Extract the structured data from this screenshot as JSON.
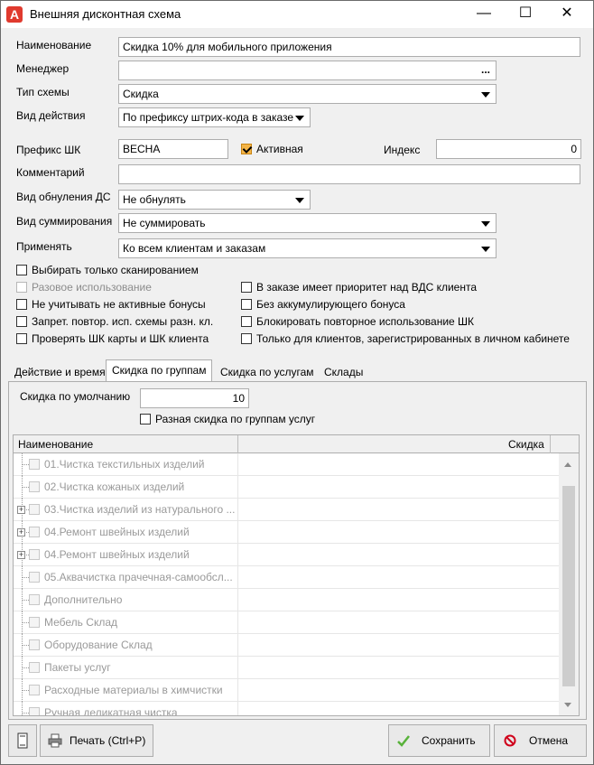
{
  "window": {
    "title": "Внешняя дисконтная схема",
    "icon_letter": "A",
    "minimize": "—",
    "maximize": "☐",
    "close": "✕"
  },
  "form": {
    "name_label": "Наименование",
    "name_value": "Скидка 10% для мобильного приложения",
    "manager_label": "Менеджер",
    "manager_value": "",
    "manager_button": "...",
    "scheme_type_label": "Тип схемы",
    "scheme_type_value": "Скидка",
    "action_type_label": "Вид действия",
    "action_type_value": "По префиксу штрих-кода в заказе",
    "prefix_label": "Префикс ШК",
    "prefix_value": "ВЕСНА",
    "active_label": "Активная",
    "active_checked": true,
    "index_label": "Индекс",
    "index_value": "0",
    "comment_label": "Комментарий",
    "comment_value": "",
    "reset_label": "Вид обнуления ДС",
    "reset_value": "Не обнулять",
    "sum_label": "Вид суммирования",
    "sum_value": "Не суммировать",
    "apply_label": "Применять",
    "apply_value": "Ко всем клиентам и заказам"
  },
  "options_left": [
    {
      "label": "Выбирать только сканированием",
      "checked": false,
      "disabled": false
    },
    {
      "label": "Разовое использование",
      "checked": false,
      "disabled": true
    },
    {
      "label": "Не учитывать не активные бонусы",
      "checked": false,
      "disabled": false
    },
    {
      "label": "Запрет. повтор. исп. схемы разн. кл.",
      "checked": false,
      "disabled": false
    },
    {
      "label": "Проверять ШК карты и ШК клиента",
      "checked": false,
      "disabled": false
    }
  ],
  "options_right": [
    {
      "label": "В заказе имеет приоритет над ВДС клиента",
      "checked": false
    },
    {
      "label": "Без аккумулирующего бонуса",
      "checked": false
    },
    {
      "label": "Блокировать повторное использование ШК",
      "checked": false
    },
    {
      "label": "Только для клиентов, зарегистрированных в личном кабинете",
      "checked": false
    }
  ],
  "tabs": [
    {
      "label": "Действие и время",
      "active": false
    },
    {
      "label": "Скидка по группам",
      "active": true
    },
    {
      "label": "Скидка по услугам",
      "active": false
    },
    {
      "label": "Склады",
      "active": false
    }
  ],
  "group_tab": {
    "default_discount_label": "Скидка по умолчанию",
    "default_discount_value": "10",
    "different_discount_label": "Разная скидка по группам услуг",
    "different_discount_checked": false
  },
  "grid": {
    "columns": [
      "Наименование",
      "Скидка"
    ],
    "rows": [
      {
        "name": "01.Чистка текстильных изделий",
        "expandable": false,
        "discount": ""
      },
      {
        "name": "02.Чистка кожаных изделий",
        "expandable": false,
        "discount": ""
      },
      {
        "name": "03.Чистка изделий из натурального ...",
        "expandable": true,
        "discount": ""
      },
      {
        "name": "04.Ремонт швейных изделий",
        "expandable": true,
        "discount": ""
      },
      {
        "name": "04.Ремонт швейных изделий",
        "expandable": true,
        "discount": ""
      },
      {
        "name": "05.Аквачистка прачечная-самообсл...",
        "expandable": false,
        "discount": ""
      },
      {
        "name": "Дополнительно",
        "expandable": false,
        "discount": ""
      },
      {
        "name": "Мебель Склад",
        "expandable": false,
        "discount": ""
      },
      {
        "name": "Оборудование Склад",
        "expandable": false,
        "discount": ""
      },
      {
        "name": "Пакеты услуг",
        "expandable": false,
        "discount": ""
      },
      {
        "name": "Расходные материалы в химчистки",
        "expandable": false,
        "discount": ""
      },
      {
        "name": "Ручная деликатная чистка",
        "expandable": false,
        "discount": ""
      }
    ]
  },
  "footer": {
    "print_label": "Печать (Ctrl+P)",
    "save_label": "Сохранить",
    "cancel_label": "Отмена"
  },
  "colors": {
    "accent_check": "#f4b446",
    "save_icon": "#58b23a",
    "cancel_icon": "#d0021b",
    "app_icon": "#e03a2e"
  }
}
